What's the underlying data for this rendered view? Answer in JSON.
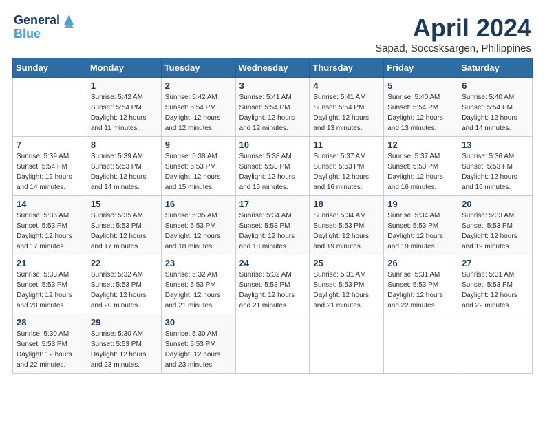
{
  "logo": {
    "line1": "General",
    "line2": "Blue"
  },
  "title": "April 2024",
  "subtitle": "Sapad, Soccsksargen, Philippines",
  "weekdays": [
    "Sunday",
    "Monday",
    "Tuesday",
    "Wednesday",
    "Thursday",
    "Friday",
    "Saturday"
  ],
  "weeks": [
    [
      {
        "day": "",
        "info": ""
      },
      {
        "day": "1",
        "info": "Sunrise: 5:42 AM\nSunset: 5:54 PM\nDaylight: 12 hours\nand 11 minutes."
      },
      {
        "day": "2",
        "info": "Sunrise: 5:42 AM\nSunset: 5:54 PM\nDaylight: 12 hours\nand 12 minutes."
      },
      {
        "day": "3",
        "info": "Sunrise: 5:41 AM\nSunset: 5:54 PM\nDaylight: 12 hours\nand 12 minutes."
      },
      {
        "day": "4",
        "info": "Sunrise: 5:41 AM\nSunset: 5:54 PM\nDaylight: 12 hours\nand 13 minutes."
      },
      {
        "day": "5",
        "info": "Sunrise: 5:40 AM\nSunset: 5:54 PM\nDaylight: 12 hours\nand 13 minutes."
      },
      {
        "day": "6",
        "info": "Sunrise: 5:40 AM\nSunset: 5:54 PM\nDaylight: 12 hours\nand 14 minutes."
      }
    ],
    [
      {
        "day": "7",
        "info": "Sunrise: 5:39 AM\nSunset: 5:54 PM\nDaylight: 12 hours\nand 14 minutes."
      },
      {
        "day": "8",
        "info": "Sunrise: 5:39 AM\nSunset: 5:53 PM\nDaylight: 12 hours\nand 14 minutes."
      },
      {
        "day": "9",
        "info": "Sunrise: 5:38 AM\nSunset: 5:53 PM\nDaylight: 12 hours\nand 15 minutes."
      },
      {
        "day": "10",
        "info": "Sunrise: 5:38 AM\nSunset: 5:53 PM\nDaylight: 12 hours\nand 15 minutes."
      },
      {
        "day": "11",
        "info": "Sunrise: 5:37 AM\nSunset: 5:53 PM\nDaylight: 12 hours\nand 16 minutes."
      },
      {
        "day": "12",
        "info": "Sunrise: 5:37 AM\nSunset: 5:53 PM\nDaylight: 12 hours\nand 16 minutes."
      },
      {
        "day": "13",
        "info": "Sunrise: 5:36 AM\nSunset: 5:53 PM\nDaylight: 12 hours\nand 16 minutes."
      }
    ],
    [
      {
        "day": "14",
        "info": "Sunrise: 5:36 AM\nSunset: 5:53 PM\nDaylight: 12 hours\nand 17 minutes."
      },
      {
        "day": "15",
        "info": "Sunrise: 5:35 AM\nSunset: 5:53 PM\nDaylight: 12 hours\nand 17 minutes."
      },
      {
        "day": "16",
        "info": "Sunrise: 5:35 AM\nSunset: 5:53 PM\nDaylight: 12 hours\nand 18 minutes."
      },
      {
        "day": "17",
        "info": "Sunrise: 5:34 AM\nSunset: 5:53 PM\nDaylight: 12 hours\nand 18 minutes."
      },
      {
        "day": "18",
        "info": "Sunrise: 5:34 AM\nSunset: 5:53 PM\nDaylight: 12 hours\nand 19 minutes."
      },
      {
        "day": "19",
        "info": "Sunrise: 5:34 AM\nSunset: 5:53 PM\nDaylight: 12 hours\nand 19 minutes."
      },
      {
        "day": "20",
        "info": "Sunrise: 5:33 AM\nSunset: 5:53 PM\nDaylight: 12 hours\nand 19 minutes."
      }
    ],
    [
      {
        "day": "21",
        "info": "Sunrise: 5:33 AM\nSunset: 5:53 PM\nDaylight: 12 hours\nand 20 minutes."
      },
      {
        "day": "22",
        "info": "Sunrise: 5:32 AM\nSunset: 5:53 PM\nDaylight: 12 hours\nand 20 minutes."
      },
      {
        "day": "23",
        "info": "Sunrise: 5:32 AM\nSunset: 5:53 PM\nDaylight: 12 hours\nand 21 minutes."
      },
      {
        "day": "24",
        "info": "Sunrise: 5:32 AM\nSunset: 5:53 PM\nDaylight: 12 hours\nand 21 minutes."
      },
      {
        "day": "25",
        "info": "Sunrise: 5:31 AM\nSunset: 5:53 PM\nDaylight: 12 hours\nand 21 minutes."
      },
      {
        "day": "26",
        "info": "Sunrise: 5:31 AM\nSunset: 5:53 PM\nDaylight: 12 hours\nand 22 minutes."
      },
      {
        "day": "27",
        "info": "Sunrise: 5:31 AM\nSunset: 5:53 PM\nDaylight: 12 hours\nand 22 minutes."
      }
    ],
    [
      {
        "day": "28",
        "info": "Sunrise: 5:30 AM\nSunset: 5:53 PM\nDaylight: 12 hours\nand 22 minutes."
      },
      {
        "day": "29",
        "info": "Sunrise: 5:30 AM\nSunset: 5:53 PM\nDaylight: 12 hours\nand 23 minutes."
      },
      {
        "day": "30",
        "info": "Sunrise: 5:30 AM\nSunset: 5:53 PM\nDaylight: 12 hours\nand 23 minutes."
      },
      {
        "day": "",
        "info": ""
      },
      {
        "day": "",
        "info": ""
      },
      {
        "day": "",
        "info": ""
      },
      {
        "day": "",
        "info": ""
      }
    ]
  ]
}
